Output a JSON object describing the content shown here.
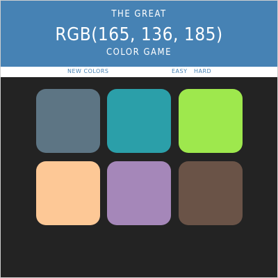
{
  "header": {
    "line1": "THE GREAT",
    "rgb": "RGB(165, 136, 185)",
    "line2": "COLOR GAME",
    "bg_color": "#4682b4"
  },
  "controls": {
    "new_colors": "NEW COLORS",
    "easy": "EASY",
    "hard": "HARD"
  },
  "squares": [
    {
      "color": "#5d7584"
    },
    {
      "color": "#2b9fa9"
    },
    {
      "color": "#9ee84d"
    },
    {
      "color": "#fdc896"
    },
    {
      "color": "#a587b9"
    },
    {
      "color": "#6a5347"
    }
  ],
  "background_color": "#232323"
}
